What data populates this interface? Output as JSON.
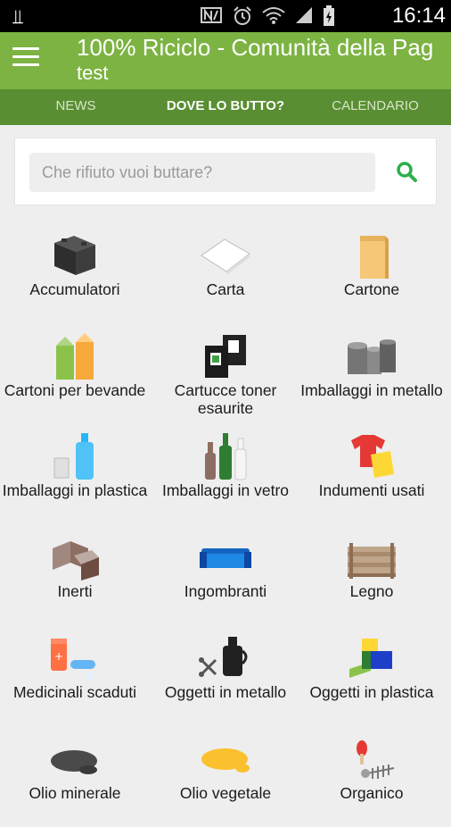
{
  "status": {
    "time": "16:14",
    "usb_icon": "usb-icon",
    "icons": [
      "nfc-icon",
      "alarm-icon",
      "wifi-icon",
      "signal-icon",
      "battery-icon"
    ]
  },
  "header": {
    "title": "100% Riciclo - Comunità della Pag",
    "subtitle": "test",
    "menu_icon": "menu-icon"
  },
  "tabs": [
    {
      "label": "NEWS",
      "active": false
    },
    {
      "label": "DOVE LO BUTTO?",
      "active": true
    },
    {
      "label": "CALENDARIO",
      "active": false
    }
  ],
  "search": {
    "placeholder": "Che rifiuto vuoi buttare?",
    "icon": "search-icon",
    "accent": "#2eae4a"
  },
  "categories": [
    {
      "label": "Accumulatori",
      "icon": "battery-accumulator-icon"
    },
    {
      "label": "Carta",
      "icon": "paper-icon"
    },
    {
      "label": "Cartone",
      "icon": "cardboard-bag-icon"
    },
    {
      "label": "Cartoni per bevande",
      "icon": "drink-cartons-icon"
    },
    {
      "label": "Cartucce toner esaurite",
      "icon": "toner-cartridge-icon"
    },
    {
      "label": "Imballaggi in metallo",
      "icon": "metal-cans-icon"
    },
    {
      "label": "Imballaggi in plastica",
      "icon": "plastic-bottle-icon"
    },
    {
      "label": "Imballaggi in vetro",
      "icon": "glass-bottles-icon"
    },
    {
      "label": "Indumenti usati",
      "icon": "used-clothes-icon"
    },
    {
      "label": "Inerti",
      "icon": "bricks-icon"
    },
    {
      "label": "Ingombranti",
      "icon": "sofa-icon"
    },
    {
      "label": "Legno",
      "icon": "wooden-crate-icon"
    },
    {
      "label": "Medicinali scaduti",
      "icon": "medicine-icon"
    },
    {
      "label": "Oggetti in metallo",
      "icon": "metal-objects-icon"
    },
    {
      "label": "Oggetti in plastica",
      "icon": "plastic-objects-icon"
    },
    {
      "label": "Olio minerale",
      "icon": "mineral-oil-icon"
    },
    {
      "label": "Olio vegetale",
      "icon": "vegetable-oil-icon"
    },
    {
      "label": "Organico",
      "icon": "organic-waste-icon"
    }
  ],
  "colors": {
    "appbar": "#7cb342",
    "tabbar": "#5a8e32",
    "background": "#eeeeee"
  }
}
